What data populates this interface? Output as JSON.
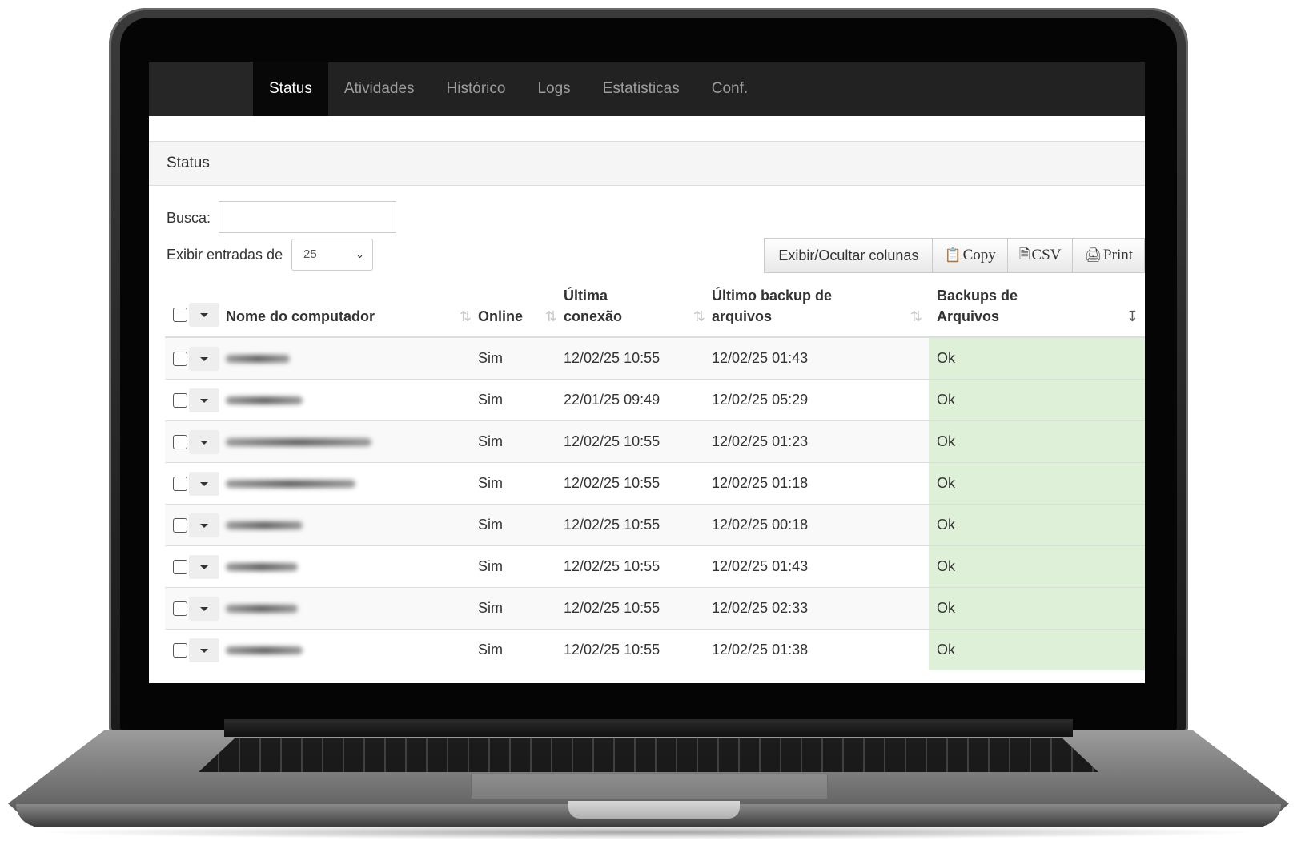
{
  "nav": {
    "tabs": [
      {
        "label": "Status",
        "active": true
      },
      {
        "label": "Atividades",
        "active": false
      },
      {
        "label": "Histórico",
        "active": false
      },
      {
        "label": "Logs",
        "active": false
      },
      {
        "label": "Estatisticas",
        "active": false
      },
      {
        "label": "Conf.",
        "active": false
      }
    ]
  },
  "panel": {
    "title": "Status"
  },
  "search": {
    "label": "Busca:",
    "value": ""
  },
  "length": {
    "label": "Exibir entradas de",
    "value": "25"
  },
  "buttons": {
    "colvis": "Exibir/Ocultar colunas",
    "copy": "Copy",
    "csv": "CSV",
    "print": "Print"
  },
  "table": {
    "headers": [
      "Nome do computador",
      "Online",
      "Última conexão",
      "Último backup de arquivos",
      "Backups de Arquivos"
    ],
    "rows": [
      {
        "online": "Sim",
        "last_connection": "12/02/25 10:55",
        "last_backup": "12/02/25 01:43",
        "status": "Ok"
      },
      {
        "online": "Sim",
        "last_connection": "22/01/25 09:49",
        "last_backup": "12/02/25 05:29",
        "status": "Ok"
      },
      {
        "online": "Sim",
        "last_connection": "12/02/25 10:55",
        "last_backup": "12/02/25 01:23",
        "status": "Ok"
      },
      {
        "online": "Sim",
        "last_connection": "12/02/25 10:55",
        "last_backup": "12/02/25 01:18",
        "status": "Ok"
      },
      {
        "online": "Sim",
        "last_connection": "12/02/25 10:55",
        "last_backup": "12/02/25 00:18",
        "status": "Ok"
      },
      {
        "online": "Sim",
        "last_connection": "12/02/25 10:55",
        "last_backup": "12/02/25 01:43",
        "status": "Ok"
      },
      {
        "online": "Sim",
        "last_connection": "12/02/25 10:55",
        "last_backup": "12/02/25 02:33",
        "status": "Ok"
      },
      {
        "online": "Sim",
        "last_connection": "12/02/25 10:55",
        "last_backup": "12/02/25 01:38",
        "status": "Ok"
      }
    ]
  },
  "colors": {
    "navbar": "#222222",
    "ok_cell": "#dff0d8"
  }
}
